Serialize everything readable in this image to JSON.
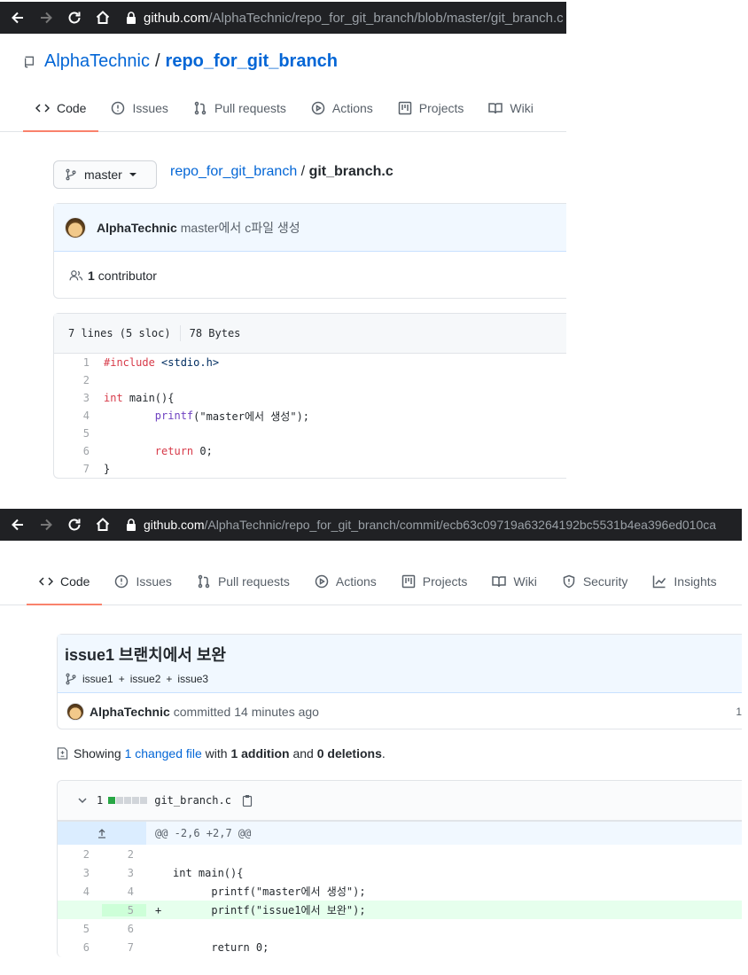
{
  "screen1": {
    "browser": {
      "url_host": "github.com",
      "url_path": "/AlphaTechnic/repo_for_git_branch/blob/master/git_branch.c"
    },
    "repo": {
      "owner": "AlphaTechnic",
      "separator": "/",
      "name": "repo_for_git_branch"
    },
    "tabs": [
      {
        "label": "Code",
        "icon": "code-icon"
      },
      {
        "label": "Issues",
        "icon": "issue-icon"
      },
      {
        "label": "Pull requests",
        "icon": "pull-request-icon"
      },
      {
        "label": "Actions",
        "icon": "play-icon"
      },
      {
        "label": "Projects",
        "icon": "project-icon"
      },
      {
        "label": "Wiki",
        "icon": "book-icon"
      }
    ],
    "branch": "master",
    "breadcrumb": {
      "repo": "repo_for_git_branch",
      "separator": "/",
      "file": "git_branch.c"
    },
    "commit": {
      "author": "AlphaTechnic",
      "message": "master에서 c파일 생성"
    },
    "contributors": {
      "count": "1",
      "label": "contributor"
    },
    "file_info": {
      "lines": "7 lines (5 sloc)",
      "size": "78 Bytes"
    },
    "code": [
      {
        "n": "1",
        "pre": "#include ",
        "kw": "",
        "text": "<stdio.h>"
      },
      {
        "n": "2",
        "text": ""
      },
      {
        "n": "3",
        "kw": "int",
        "text": " main(){"
      },
      {
        "n": "4",
        "indent": "        ",
        "fn": "printf",
        "text": "(\"master에서 생성\");"
      },
      {
        "n": "5",
        "text": ""
      },
      {
        "n": "6",
        "indent": "        ",
        "kw": "return",
        "text": " 0;"
      },
      {
        "n": "7",
        "text": "}"
      }
    ]
  },
  "screen2": {
    "browser": {
      "url_host": "github.com",
      "url_path": "/AlphaTechnic/repo_for_git_branch/commit/ecb63c09719a63264192bc5531b4ea396ed010ca"
    },
    "tabs": [
      {
        "label": "Code",
        "icon": "code-icon"
      },
      {
        "label": "Issues",
        "icon": "issue-icon"
      },
      {
        "label": "Pull requests",
        "icon": "pull-request-icon"
      },
      {
        "label": "Actions",
        "icon": "play-icon"
      },
      {
        "label": "Projects",
        "icon": "project-icon"
      },
      {
        "label": "Wiki",
        "icon": "book-icon"
      },
      {
        "label": "Security",
        "icon": "shield-icon"
      },
      {
        "label": "Insights",
        "icon": "graph-icon"
      }
    ],
    "commit_title": "issue1 브랜치에서 보완",
    "branches": [
      "issue1",
      "+",
      "issue2",
      "+",
      "issue3"
    ],
    "author": "AlphaTechnic",
    "committed_text": "committed 14 minutes ago",
    "right_truncated": "1",
    "summary": {
      "showing": "Showing",
      "changed": "1 changed file",
      "with": "with",
      "additions": "1 addition",
      "and": "and",
      "deletions": "0 deletions",
      "end": "."
    },
    "diff_file": {
      "count": "1",
      "name": "git_branch.c"
    },
    "hunk": "@@ -2,6 +2,7 @@",
    "diff": [
      {
        "old": "2",
        "new": "2",
        "sign": "",
        "code": ""
      },
      {
        "old": "3",
        "new": "3",
        "sign": "",
        "code": "int main(){"
      },
      {
        "old": "4",
        "new": "4",
        "sign": "",
        "code": "      printf(\"master에서 생성\");"
      },
      {
        "old": "",
        "new": "5",
        "sign": "+",
        "code": "      printf(\"issue1에서 보완\");",
        "added": true
      },
      {
        "old": "5",
        "new": "6",
        "sign": "",
        "code": ""
      },
      {
        "old": "6",
        "new": "7",
        "sign": "",
        "code": "      return 0;"
      }
    ]
  },
  "colors": {
    "link": "#0366d6",
    "tab_underline": "#f9826c",
    "addition": "#e6ffed",
    "addition_gutter": "#cdffd8",
    "commit_bg": "#f1f8ff"
  }
}
